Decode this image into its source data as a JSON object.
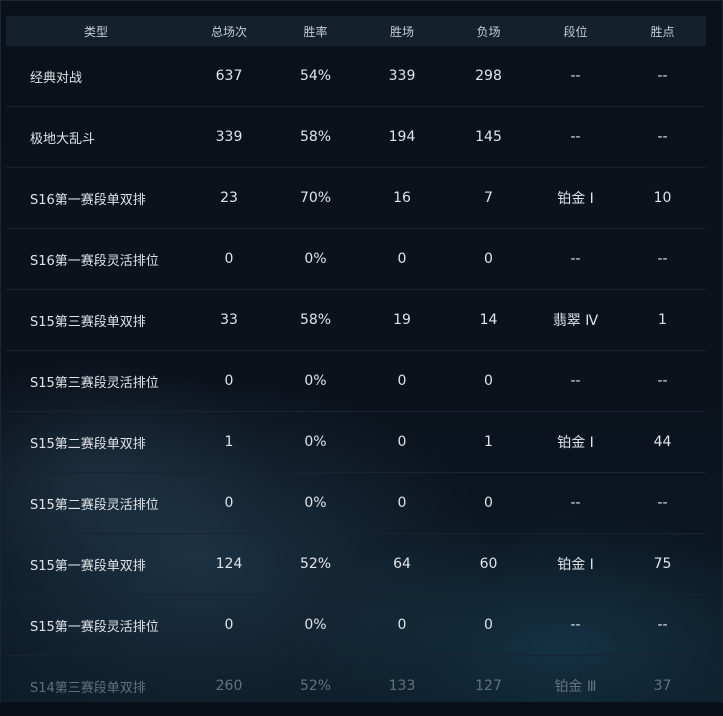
{
  "columns": [
    "类型",
    "总场次",
    "胜率",
    "胜场",
    "负场",
    "段位",
    "胜点"
  ],
  "rows": [
    {
      "type": "经典对战",
      "total": "637",
      "winrate": "54%",
      "wins": "339",
      "losses": "298",
      "rank": "--",
      "lp": "--"
    },
    {
      "type": "极地大乱斗",
      "total": "339",
      "winrate": "58%",
      "wins": "194",
      "losses": "145",
      "rank": "--",
      "lp": "--"
    },
    {
      "type": "S16第一赛段单双排",
      "total": "23",
      "winrate": "70%",
      "wins": "16",
      "losses": "7",
      "rank": "铂金 Ⅰ",
      "lp": "10"
    },
    {
      "type": "S16第一赛段灵活排位",
      "total": "0",
      "winrate": "0%",
      "wins": "0",
      "losses": "0",
      "rank": "--",
      "lp": "--"
    },
    {
      "type": "S15第三赛段单双排",
      "total": "33",
      "winrate": "58%",
      "wins": "19",
      "losses": "14",
      "rank": "翡翠 Ⅳ",
      "lp": "1"
    },
    {
      "type": "S15第三赛段灵活排位",
      "total": "0",
      "winrate": "0%",
      "wins": "0",
      "losses": "0",
      "rank": "--",
      "lp": "--"
    },
    {
      "type": "S15第二赛段单双排",
      "total": "1",
      "winrate": "0%",
      "wins": "0",
      "losses": "1",
      "rank": "铂金 Ⅰ",
      "lp": "44"
    },
    {
      "type": "S15第二赛段灵活排位",
      "total": "0",
      "winrate": "0%",
      "wins": "0",
      "losses": "0",
      "rank": "--",
      "lp": "--"
    },
    {
      "type": "S15第一赛段单双排",
      "total": "124",
      "winrate": "52%",
      "wins": "64",
      "losses": "60",
      "rank": "铂金 Ⅰ",
      "lp": "75"
    },
    {
      "type": "S15第一赛段灵活排位",
      "total": "0",
      "winrate": "0%",
      "wins": "0",
      "losses": "0",
      "rank": "--",
      "lp": "--"
    },
    {
      "type": "S14第三赛段单双排",
      "total": "260",
      "winrate": "52%",
      "wins": "133",
      "losses": "127",
      "rank": "铂金 Ⅲ",
      "lp": "37"
    }
  ]
}
